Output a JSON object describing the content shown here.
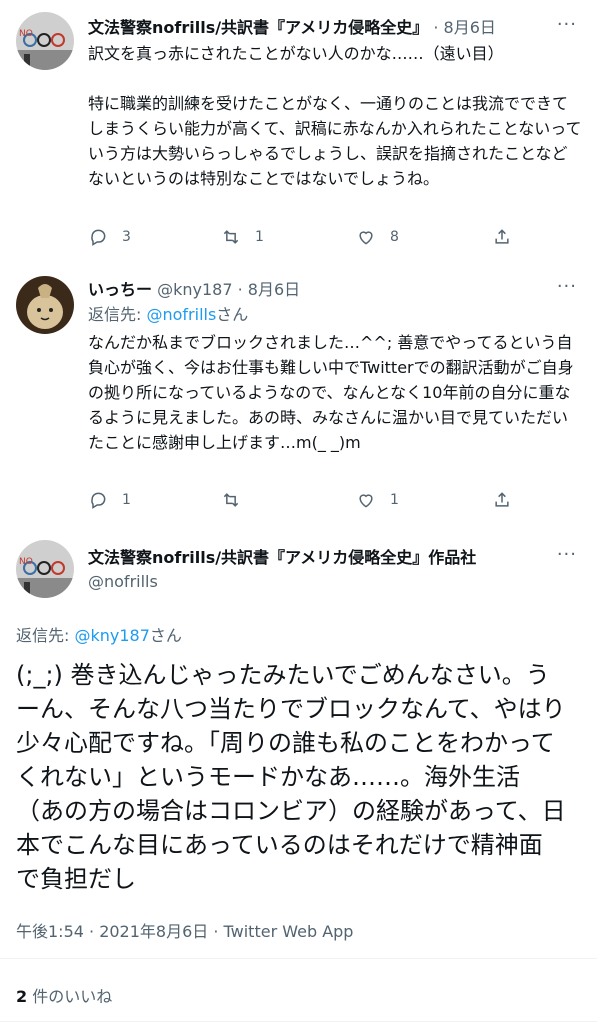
{
  "tweet1": {
    "name": "文法警察nofrills/共訳書『アメリカ侵略全史』",
    "date": "· 8月6日",
    "text": "訳文を真っ赤にされたことがない人のかな……（遠い目）\n\n特に職業的訓練を受けたことがなく、一通りのことは我流でできてしまうくらい能力が高くて、訳稿に赤なんか入れられたことないっていう方は大勢いらっしゃるでしょうし、誤訳を指摘されたことなどないというのは特別なことではないでしょうね。",
    "reply_count": "3",
    "retweet_count": "1",
    "like_count": "8"
  },
  "tweet2": {
    "name": "いっちー",
    "handle": "@kny187",
    "date": "· 8月6日",
    "reply_prefix": "返信先: ",
    "reply_to": "@nofrills",
    "reply_suffix": "さん",
    "text": "なんだか私までブロックされました…^^; 善意でやってるという自負心が強く、今はお仕事も難しい中でTwitterでの翻訳活動がご自身の拠り所になっているようなので、なんとなく10年前の自分に重なるように見えました。あの時、みなさんに温かい目で見ていただいたことに感謝申し上げます…m(_ _)m",
    "reply_count": "1",
    "like_count": "1"
  },
  "main": {
    "name": "文法警察nofrills/共訳書『アメリカ侵略全史』作品社",
    "handle": "@nofrills",
    "reply_prefix": "返信先: ",
    "reply_to": "@kny187",
    "reply_suffix": "さん",
    "text": "(;_;) 巻き込んじゃったみたいでごめんなさい。うーん、そんな八つ当たりでブロックなんて、やはり少々心配ですね。「周りの誰も私のことをわかってくれない」というモードかなあ……。海外生活（あの方の場合はコロンビア）の経験があって、日本でこんな目にあっているのはそれだけで精神面で負担だし",
    "timestamp": "午後1:54 · 2021年8月6日 · Twitter Web App",
    "likes_count": "2",
    "likes_label": " 件のいいね"
  },
  "icons": [
    "more-icon",
    "reply-icon",
    "retweet-icon",
    "like-icon",
    "share-icon"
  ],
  "colors": {
    "accent": "#1d9bf0",
    "muted": "#536471",
    "text": "#0f1419",
    "divider": "#eff3f4"
  }
}
